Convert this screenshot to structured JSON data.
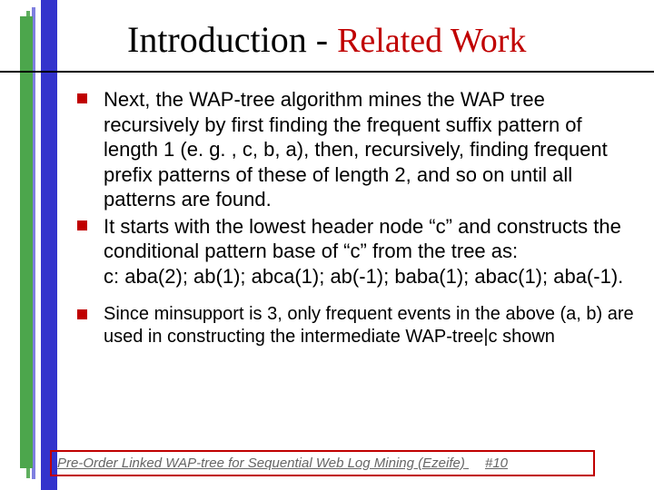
{
  "title": {
    "part1": "Introduction - ",
    "part2": "Related Work"
  },
  "bullets": [
    "Next, the WAP-tree algorithm mines the WAP tree recursively by first finding the frequent suffix pattern of length 1 (e. g. , c, b, a), then, recursively, finding frequent prefix patterns of these of length 2, and so on until all patterns are found.",
    "It starts with the lowest header node “c” and constructs the conditional pattern base of “c” from the tree as:\nc: aba(2); ab(1); abca(1); ab(-1); baba(1); abac(1); aba(-1).",
    "Since minsupport is 3, only frequent events in the above (a, b) are used in constructing the intermediate WAP-tree|c shown"
  ],
  "footer": {
    "text": "Pre-Order Linked WAP-tree for Sequential Web Log Mining (Ezeife)",
    "page": "#10"
  }
}
